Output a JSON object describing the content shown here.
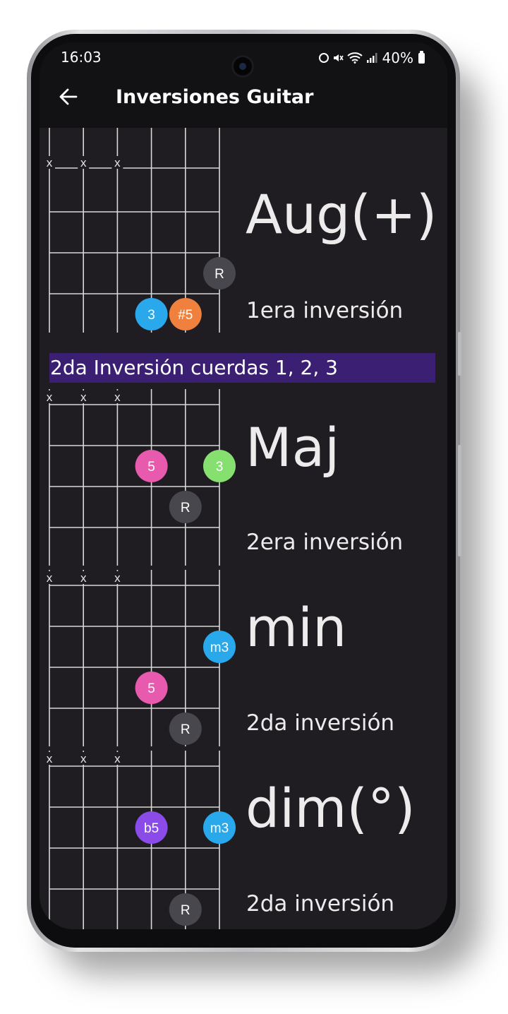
{
  "status_bar": {
    "time": "16:03",
    "battery": "40%",
    "icons": [
      "alarm-icon",
      "mute-icon",
      "wifi-icon",
      "signal-icon",
      "battery-icon"
    ]
  },
  "app_bar": {
    "back_icon": "arrow-left-icon",
    "title": "Inversiones Guitar"
  },
  "section_banner": "2da Inversión cuerdas 1, 2, 3",
  "chords": [
    {
      "name": "Aug(+)",
      "inversion": "1era inversión",
      "muted_marker": "x",
      "muted_strings": [
        1,
        2,
        3
      ],
      "dots": [
        {
          "string": 6,
          "fret": 3,
          "label": "R",
          "color": "#47474d"
        },
        {
          "string": 4,
          "fret": 4,
          "label": "3",
          "color": "#2aa8ec"
        },
        {
          "string": 5,
          "fret": 4,
          "label": "#5",
          "color": "#f0803e"
        }
      ]
    },
    {
      "name": "Maj",
      "inversion": "2era inversión",
      "muted_marker": "x",
      "muted_strings": [
        1,
        2,
        3
      ],
      "dots": [
        {
          "string": 4,
          "fret": 2,
          "label": "5",
          "color": "#e85aae"
        },
        {
          "string": 6,
          "fret": 2,
          "label": "3",
          "color": "#86e070"
        },
        {
          "string": 5,
          "fret": 3,
          "label": "R",
          "color": "#47474d"
        }
      ]
    },
    {
      "name": "min",
      "inversion": "2da inversión",
      "muted_marker": "x",
      "muted_strings": [
        1,
        2,
        3
      ],
      "dots": [
        {
          "string": 6,
          "fret": 2,
          "label": "m3",
          "color": "#2aa8ec"
        },
        {
          "string": 4,
          "fret": 3,
          "label": "5",
          "color": "#e85aae"
        },
        {
          "string": 5,
          "fret": 4,
          "label": "R",
          "color": "#47474d"
        }
      ]
    },
    {
      "name": "dim(°)",
      "inversion": "2da inversión",
      "muted_marker": "x",
      "muted_strings": [
        1,
        2,
        3
      ],
      "dots": [
        {
          "string": 4,
          "fret": 2,
          "label": "b5",
          "color": "#8a4be8"
        },
        {
          "string": 6,
          "fret": 2,
          "label": "m3",
          "color": "#2aa8ec"
        },
        {
          "string": 5,
          "fret": 4,
          "label": "R",
          "color": "#47474d"
        }
      ]
    }
  ]
}
